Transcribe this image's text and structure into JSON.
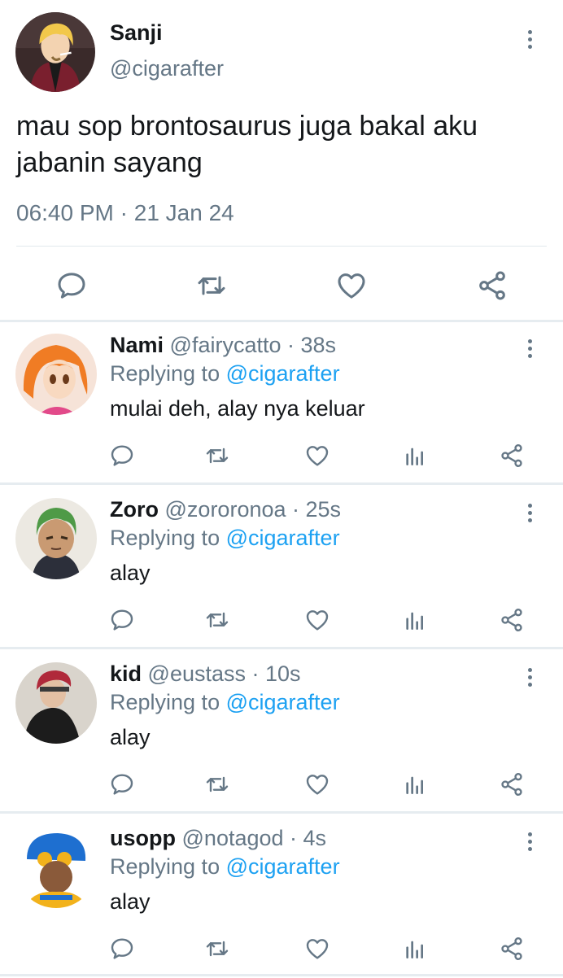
{
  "main_tweet": {
    "name": "Sanji",
    "handle": "@cigarafter",
    "text": "mau sop brontosaurus juga bakal aku jabanin sayang",
    "time": "06:40 PM",
    "separator": " · ",
    "date": "21 Jan 24",
    "avatar_colors": {
      "bg": "#3a2a2a",
      "hair": "#f2c84b",
      "skin": "#f3d3b1",
      "suit": "#7a1f2e"
    }
  },
  "actions": {
    "reply_icon": "speech-bubble-icon",
    "retweet_icon": "retweet-icon",
    "like_icon": "heart-icon",
    "analytics_icon": "bar-chart-icon",
    "share_icon": "share-icon"
  },
  "replying_label": "Replying to",
  "replies": [
    {
      "name": "Nami",
      "handle": "@fairycatto",
      "time": "38s",
      "reply_to": "@cigarafter",
      "text": "mulai deh, alay nya keluar",
      "avatar_colors": {
        "bg": "#f6e3d8",
        "hair": "#f07c24",
        "skin": "#f8d9c0",
        "accent": "#e24a8a"
      }
    },
    {
      "name": "Zoro",
      "handle": "@zororonoa",
      "time": "25s",
      "reply_to": "@cigarafter",
      "text": "alay",
      "avatar_colors": {
        "bg": "#ece9e2",
        "hair": "#4f9a47",
        "skin": "#c99a72",
        "accent": "#2c2f3a"
      }
    },
    {
      "name": "kid",
      "handle": "@eustass",
      "time": "10s",
      "reply_to": "@cigarafter",
      "text": "alay",
      "avatar_colors": {
        "bg": "#d9d4cc",
        "hair": "#b0293a",
        "skin": "#e3c0a4",
        "accent": "#1c1c1c"
      }
    },
    {
      "name": "usopp",
      "handle": "@notagod",
      "time": "4s",
      "reply_to": "@cigarafter",
      "text": "alay",
      "avatar_colors": {
        "bg": "#ffffff",
        "hair": "#1e6fd0",
        "skin": "#8a5a3a",
        "accent": "#f2b21c"
      }
    }
  ],
  "colors": {
    "text": "#14171a",
    "muted": "#657786",
    "link": "#1da1f2",
    "divider": "#e6ecf0"
  }
}
